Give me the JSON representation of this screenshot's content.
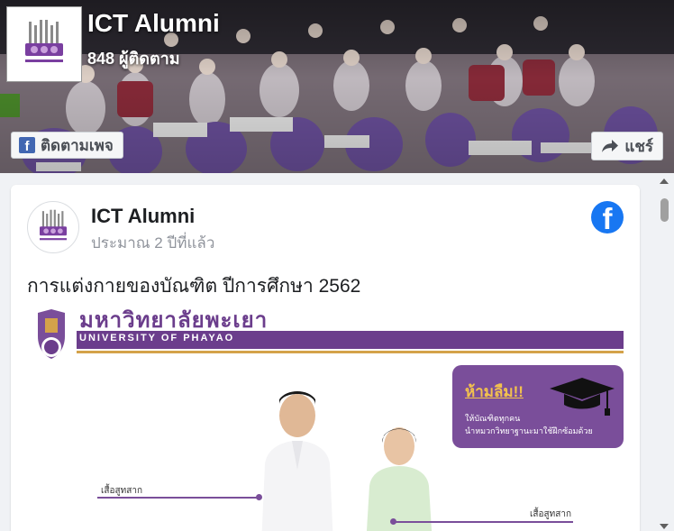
{
  "page": {
    "name": "ICT Alumni",
    "followers": "848 ผู้ติดตาม",
    "follow_label": "ติดตามเพจ",
    "share_label": "แชร์"
  },
  "post": {
    "author": "ICT Alumni",
    "time": "ประมาณ 2 ปีที่แล้ว",
    "text": "การแต่งกายของบัณฑิต ปีการศึกษา 2562"
  },
  "post_image": {
    "university_th": "มหาวิทยาลัยพะเยา",
    "university_en": "UNIVERSITY OF PHAYAO",
    "notice_title": "ห้ามลืม!!",
    "notice_line1": "ให้บัณฑิตทุกคน",
    "notice_line2": "นำหมวกวิทยาฐานะมาใช้ฝึกซ้อมด้วย",
    "caption_left": "เสื้อสูทสาก",
    "caption_right": "เสื้อสูทสาก"
  },
  "colors": {
    "facebook_blue": "#1877f2",
    "university_purple": "#6b3d8c",
    "gold": "#d4a24a"
  },
  "icons": [
    "ict-logo-icon",
    "facebook-square-icon",
    "share-arrow-icon",
    "facebook-logo-icon",
    "graduation-cap-icon"
  ]
}
